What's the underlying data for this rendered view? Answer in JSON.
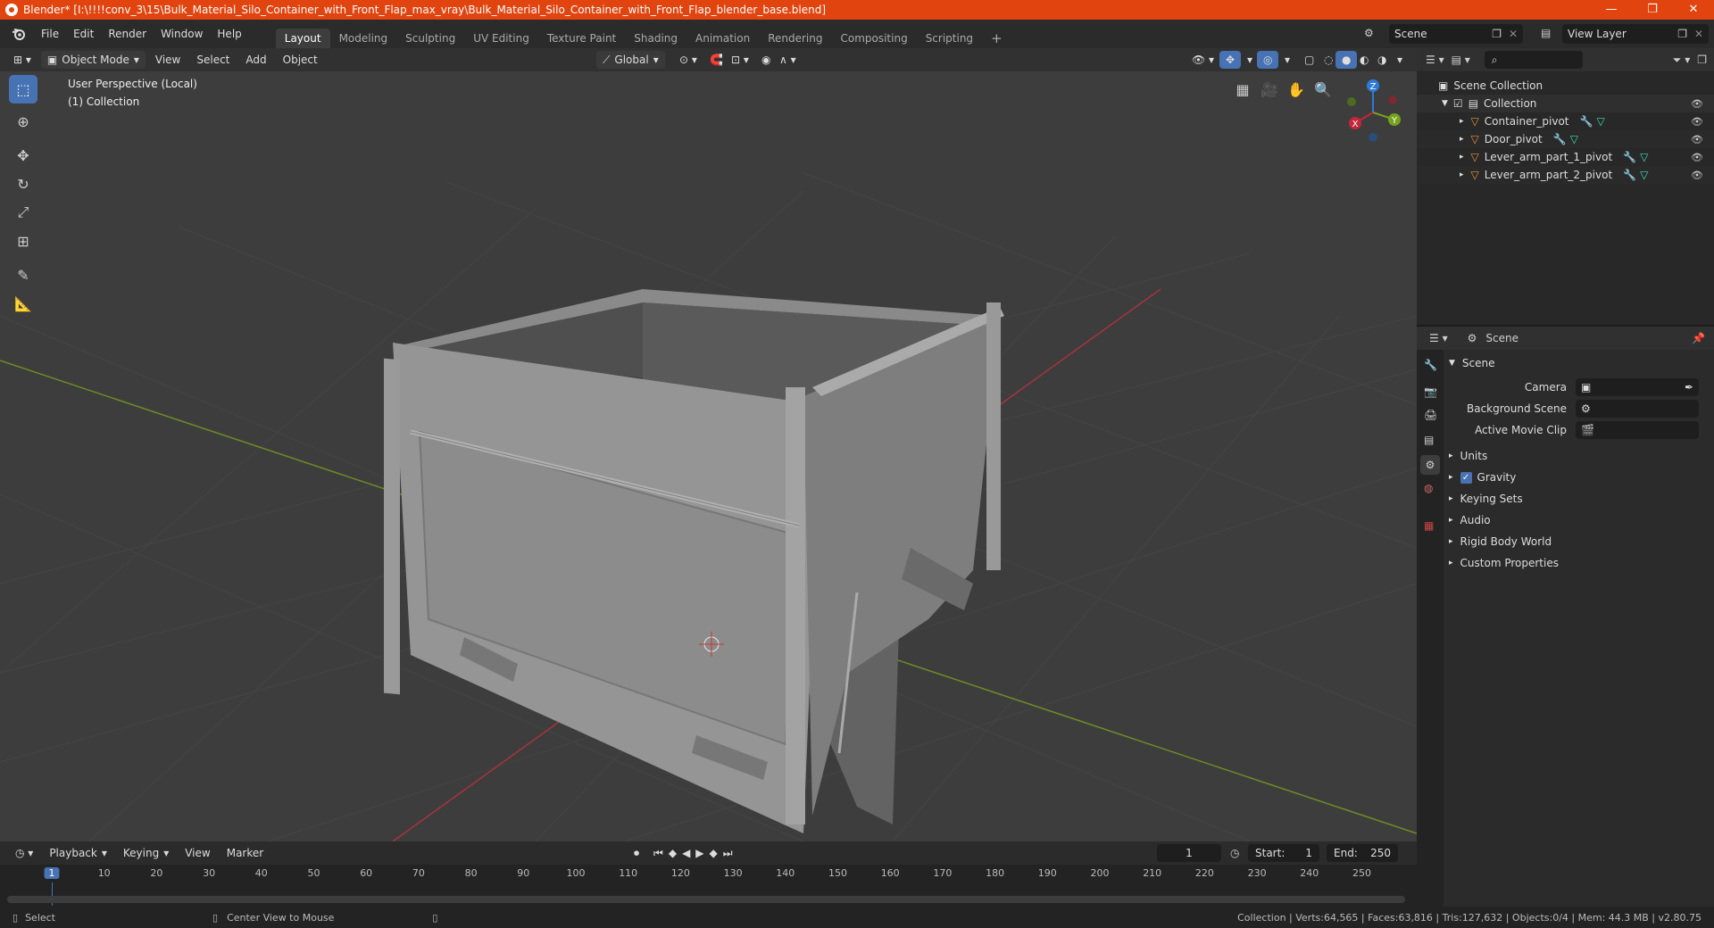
{
  "title_bar": {
    "text": "Blender* [I:\\!!!!conv_3\\15\\Bulk_Material_Silo_Container_with_Front_Flap_max_vray\\Bulk_Material_Silo_Container_with_Front_Flap_blender_base.blend]",
    "minimize": "—",
    "restore": "❐",
    "close": "✕"
  },
  "menu": [
    "File",
    "Edit",
    "Render",
    "Window",
    "Help"
  ],
  "workspaces": [
    "Layout",
    "Modeling",
    "Sculpting",
    "UV Editing",
    "Texture Paint",
    "Shading",
    "Animation",
    "Rendering",
    "Compositing",
    "Scripting"
  ],
  "add_workspace": "+",
  "scene": {
    "name": "Scene",
    "view_layer": "View Layer"
  },
  "viewport_header": {
    "mode": "Object Mode",
    "menus": [
      "View",
      "Select",
      "Add",
      "Object"
    ],
    "orientation": "Global"
  },
  "viewport": {
    "perspective": "User Perspective (Local)",
    "collection": "(1) Collection"
  },
  "gizmo": {
    "x": "X",
    "y": "Y",
    "z": "Z"
  },
  "outliner": {
    "search_placeholder": "",
    "root": "Scene Collection",
    "collection": "Collection",
    "items": [
      "Container_pivot",
      "Door_pivot",
      "Lever_arm_part_1_pivot",
      "Lever_arm_part_2_pivot"
    ]
  },
  "properties": {
    "header": "Scene",
    "panel": "Scene",
    "camera_label": "Camera",
    "background_label": "Background Scene",
    "clip_label": "Active Movie Clip",
    "sections": [
      "Units",
      "Gravity",
      "Keying Sets",
      "Audio",
      "Rigid Body World",
      "Custom Properties"
    ]
  },
  "timeline": {
    "menus": [
      "Playback",
      "Keying",
      "View",
      "Marker"
    ],
    "current_frame": "1",
    "start_label": "Start:",
    "start": "1",
    "end_label": "End:",
    "end": "250",
    "ticks": [
      "1",
      "10",
      "20",
      "30",
      "40",
      "50",
      "60",
      "70",
      "80",
      "90",
      "100",
      "110",
      "120",
      "130",
      "140",
      "150",
      "160",
      "170",
      "180",
      "190",
      "200",
      "210",
      "220",
      "230",
      "240",
      "250"
    ]
  },
  "status_bar": {
    "select": "Select",
    "center": "Center View to Mouse",
    "stats": "Collection | Verts:64,565 | Faces:63,816 | Tris:127,632 | Objects:0/4 | Mem: 44.3 MB | v2.80.75"
  },
  "colors": {
    "accent": "#4772b3",
    "title": "#e1440f",
    "x_axis": "#c4263c",
    "y_axis": "#76a21e",
    "z_axis": "#2e7bd6"
  }
}
